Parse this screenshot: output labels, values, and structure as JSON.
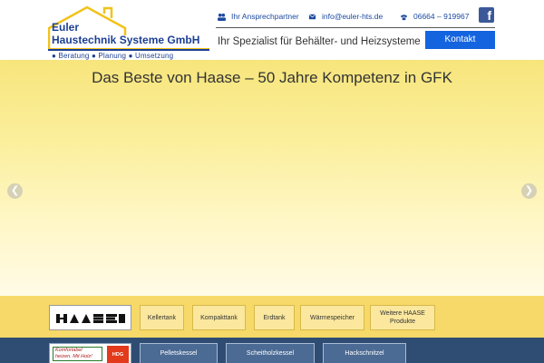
{
  "header": {
    "logo": {
      "line1": "Euler",
      "line2": "Haustechnik Systeme GmbH",
      "tagline": "● Beratung  ● Planung  ● Umsetzung"
    },
    "contact": {
      "partner_label": "Ihr Ansprechpartner",
      "email": "info@euler-hts.de",
      "phone": "06664 – 919967"
    },
    "tagline": "Ihr Spezialist für Behälter- und Heizsysteme",
    "kontakt_label": "Kontakt",
    "social_icon": "facebook-icon"
  },
  "slider": {
    "title": "Das Beste von Haase – 50 Jahre Kompetenz in GFK",
    "prev_icon": "chevron-left-icon",
    "next_icon": "chevron-right-icon"
  },
  "brand_rows": [
    {
      "brand": "HAASE",
      "products": [
        "Kellertank",
        "Kompakttank",
        "Erdtank",
        "Wärmespeicher",
        "Weitere HAASE Produkte"
      ]
    },
    {
      "brand_texts": {
        "line1": "Komfortabel",
        "line2": "heizen. Mit Holz!",
        "badge": "HDG"
      },
      "products": [
        "Pelletskessel",
        "Scheitholzkessel",
        "Hackschnitzel"
      ]
    }
  ],
  "colors": {
    "brand_blue": "#1c3f94",
    "accent_blue": "#1464e0",
    "slider_yellow": "#f7e57c",
    "row1_bg": "#f6d968",
    "row2_bg": "#2f4c72",
    "facebook": "#3b5998"
  }
}
